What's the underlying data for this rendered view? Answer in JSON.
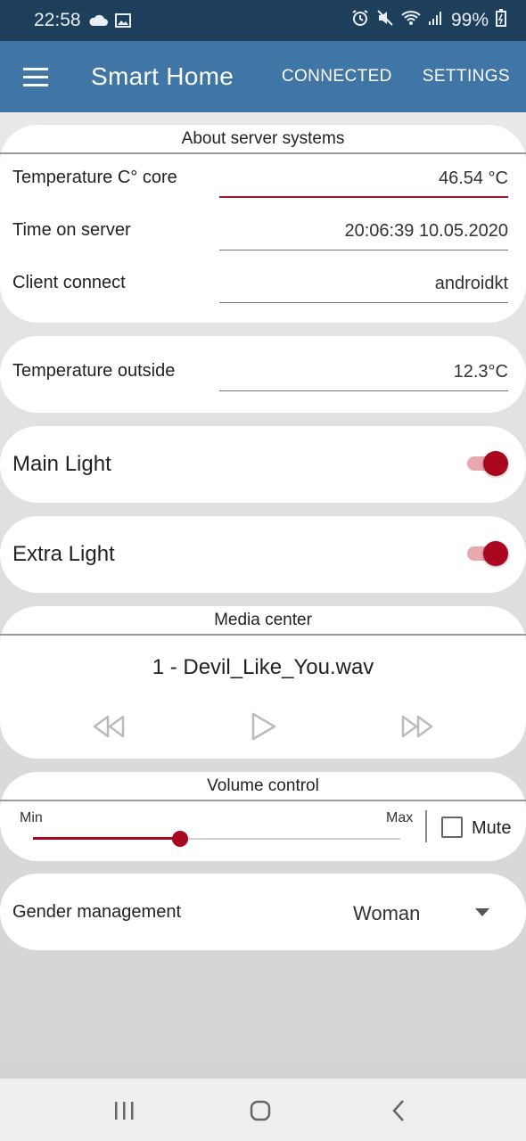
{
  "status_bar": {
    "time": "22:58",
    "battery": "99%",
    "left_icons": [
      "cloud-icon",
      "image-icon"
    ],
    "right_icons": [
      "alarm-icon",
      "mute-icon",
      "wifi-icon",
      "signal-icon",
      "battery-icon"
    ]
  },
  "app_bar": {
    "title": "Smart Home",
    "actions": [
      "CONNECTED",
      "SETTINGS"
    ],
    "color": "#3f76a5"
  },
  "server_card": {
    "header": "About server systems",
    "fields": [
      {
        "label": "Temperature C° core",
        "value": "46.54 °C"
      },
      {
        "label": "Time on server",
        "value": "20:06:39 10.05.2020"
      },
      {
        "label": "Client connect",
        "value": "androidkt"
      }
    ]
  },
  "outside_card": {
    "label": "Temperature outside",
    "value": "12.3°C"
  },
  "main_light": {
    "label": "Main Light",
    "on": true
  },
  "extra_light": {
    "label": "Extra Light",
    "on": true
  },
  "media_card": {
    "header": "Media center",
    "track": "1 - Devil_Like_You.wav",
    "controls": [
      "rewind-icon",
      "play-icon",
      "fast-forward-icon"
    ]
  },
  "volume_card": {
    "header": "Volume control",
    "min_label": "Min",
    "max_label": "Max",
    "level": 0.4,
    "mute_label": "Mute",
    "muted": false
  },
  "gender_card": {
    "label": "Gender management",
    "selected": "Woman"
  },
  "accent_color": "#a9061f"
}
